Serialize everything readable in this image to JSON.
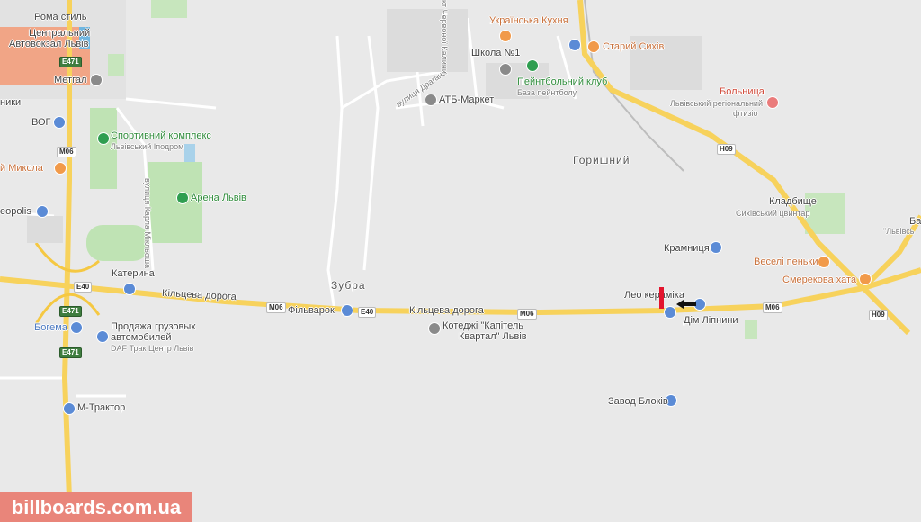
{
  "map": {
    "labels": {
      "roma_stil": "Рома стиль",
      "central_bus": "Центральний",
      "avtovokzal": "Автовокзал Львів",
      "metgal": "Метгал",
      "niky": "ники",
      "vog": "ВОГ",
      "sport_complex": "Спортивний комплекс",
      "lviv_ipodrom": "Львівський Іподром",
      "mykola": "й Микола",
      "arena": "Арена Львів",
      "leopolis": "eopolis",
      "karla_street": "вулиця Карла Мікльоша",
      "kateryna": "Катерина",
      "ring_road_left": "Кільцева дорога",
      "ring_road_mid": "Кільцева дорога",
      "filvarok": "Фільварок",
      "bogema": "Богема",
      "trucks_sale": "Продажа грузовых",
      "trucks_sale2": "автомобилей",
      "daf": "DAF Трак Центр Львів",
      "m_traktor": "М-Трактор",
      "zubra": "Зубра",
      "draghana": "вулиця Драгана",
      "chervonoi": "кт Червоної Калини",
      "atb": "АТБ-Маркет",
      "ukr_kitchen": "Українська Кухня",
      "school": "Школа №1",
      "paintball": "Пейнтбольний клуб",
      "paintball_sub": "База пейнтболу",
      "stary_sykhiv": "Старий Сихів",
      "hospital": "Больница",
      "hospital_sub": "Львівський регіональний",
      "hospital_sub2": "фтизіо",
      "goryshniy": "Горишний",
      "cemetery": "Кладбище",
      "cemetery_sub": "Сихівський цвинтар",
      "kramnytsia": "Крамниця",
      "veseli": "Веселі пеньки",
      "smerekova": "Смерекова хата",
      "leo": "Лео керамiка",
      "dim_lipnyny": "Дім Ліпнини",
      "cottages": "Котеджі \"Капітель",
      "cottages2": "Квартал\" Львів",
      "blocks": "Завод Блоків",
      "ba": "Ба",
      "lviv_right": "\"Львівсь"
    },
    "shields": {
      "e471_top": "E471",
      "m06_left": "M06",
      "e40_left": "E40",
      "e471_mid": "E471",
      "e471_low": "E471",
      "m06_mid": "M06",
      "e40_mid": "E40",
      "m06_center": "M06",
      "m06_right": "M06",
      "h09_top": "H09",
      "h09_right": "H09"
    },
    "watermark": "billboards.com.ua"
  }
}
